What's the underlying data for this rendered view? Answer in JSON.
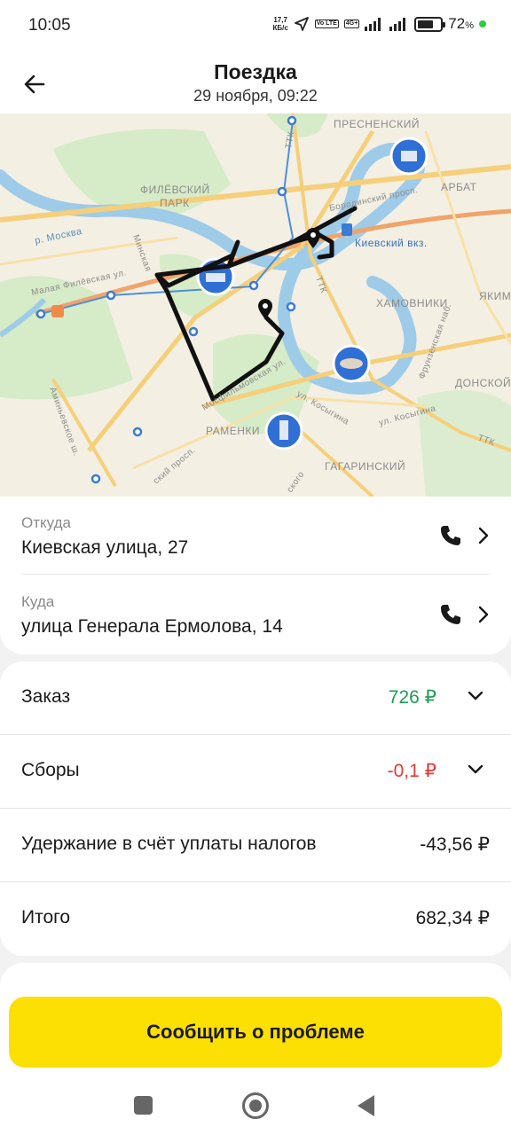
{
  "status_bar": {
    "time": "10:05",
    "net_speed_top": "17,7",
    "net_speed_bottom": "КБ/с",
    "volte": "Vo LTE",
    "network": "4G+",
    "battery_percent": "72",
    "battery_unit": "%",
    "battery_level": 0.72
  },
  "header": {
    "title": "Поездка",
    "subtitle": "29 ноября, 09:22"
  },
  "map": {
    "labels": {
      "presnensky": "ПРЕСНЕНСКИЙ",
      "arbat": "АРБАТ",
      "filevsky_park_1": "ФИЛЁВСКИЙ",
      "filevsky_park_2": "ПАРК",
      "moskva": "р. Москва",
      "malaya_filevskaya": "Малая Филёвская ул.",
      "minskaya": "Минская",
      "kievsky_vokzal": "Киевский вкз.",
      "khamovniki": "ХАМОВНИКИ",
      "frunzenskaya": "Фрунзенская наб.",
      "yakimanka": "ЯКИМ",
      "donskoy": "ДОНСКОЙ",
      "ttk_1": "ТТК",
      "ttk_2": "ТТК",
      "ttk_3": "ТТК",
      "ramenki": "РАМЕНКИ",
      "gagarinsky": "ГАГАРИНСКИЙ",
      "kosygina_1": "ул. Косыгина",
      "kosygina_2": "ул. Косыгина",
      "aminievskoe": "Аминьевское ш.",
      "mosfilmovskaya": "Мосфильмовская ул.",
      "borodinsky": "Бородинский просп.",
      "vernadskogo": "ский просп.",
      "moskovskogo": "ского"
    }
  },
  "trip": {
    "from_label": "Откуда",
    "from_value": "Киевская улица, 27",
    "to_label": "Куда",
    "to_value": "улица Генерала Ермолова, 14"
  },
  "finance": {
    "order_label": "Заказ",
    "order_value": "726 ₽",
    "fees_label": "Сборы",
    "fees_value": "-0,1 ₽",
    "tax_label": "Удержание в счёт уплаты налогов",
    "tax_value": "-43,56 ₽",
    "total_label": "Итого",
    "total_value": "682,34 ₽"
  },
  "actions": {
    "report_problem": "Сообщить о проблеме"
  },
  "colors": {
    "accent_yellow": "#fcdf03",
    "positive_green": "#1f9d55",
    "negative_red": "#e53935"
  }
}
